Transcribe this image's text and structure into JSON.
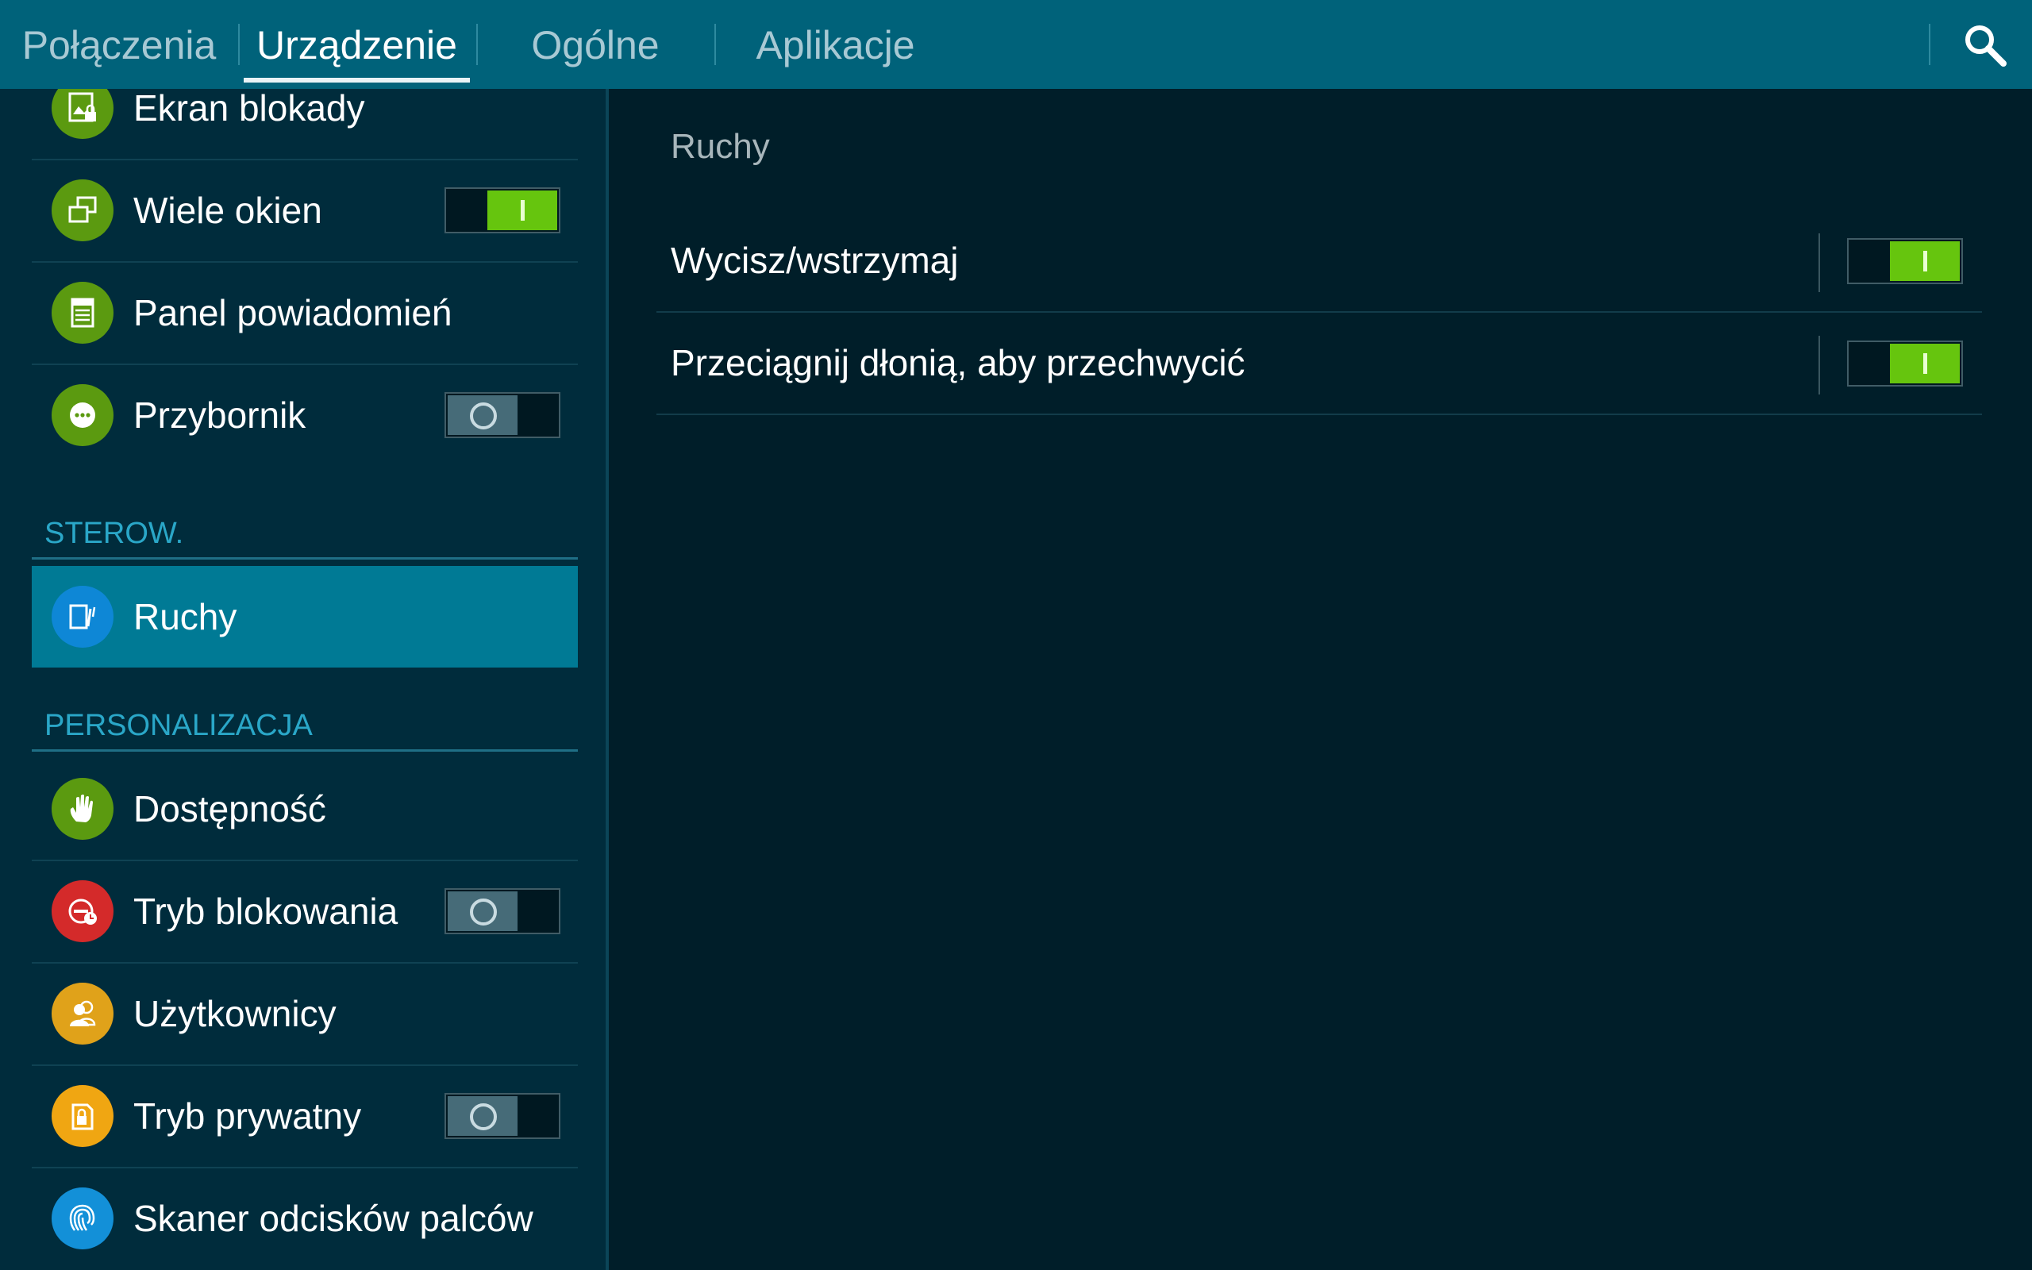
{
  "tabs": [
    {
      "label": "Połączenia",
      "active": false
    },
    {
      "label": "Urządzenie",
      "active": true
    },
    {
      "label": "Ogólne",
      "active": false
    },
    {
      "label": "Aplikacje",
      "active": false
    }
  ],
  "search_icon": "search-icon",
  "left_menu": {
    "items_top": [
      {
        "label": "Ekran blokady",
        "icon": "lock-screen-icon",
        "icon_color": "#5b9a10"
      },
      {
        "label": "Wiele okien",
        "icon": "multi-window-icon",
        "icon_color": "#5b9a10",
        "toggle": "on"
      },
      {
        "label": "Panel powiadomień",
        "icon": "notification-panel-icon",
        "icon_color": "#5b9a10"
      },
      {
        "label": "Przybornik",
        "icon": "toolbox-icon",
        "icon_color": "#5b9a10",
        "toggle": "off"
      }
    ],
    "section_sterow": "STEROW.",
    "ruchy_item": {
      "label": "Ruchy",
      "icon": "motions-icon",
      "icon_color": "#0e87d6",
      "selected": true
    },
    "section_personalizacja": "PERSONALIZACJA",
    "items_bottom": [
      {
        "label": "Dostępność",
        "icon": "accessibility-hand-icon",
        "icon_color": "#5b9a10"
      },
      {
        "label": "Tryb blokowania",
        "icon": "blocking-mode-icon",
        "icon_color": "#d42a2a",
        "toggle": "off"
      },
      {
        "label": "Użytkownicy",
        "icon": "users-icon",
        "icon_color": "#e0a21a"
      },
      {
        "label": "Tryb prywatny",
        "icon": "private-mode-icon",
        "icon_color": "#f0a612",
        "toggle": "off"
      },
      {
        "label": "Skaner odcisków palców",
        "icon": "fingerprint-icon",
        "icon_color": "#1390d8"
      }
    ]
  },
  "detail": {
    "title": "Ruchy",
    "rows": [
      {
        "label": "Wycisz/wstrzymaj",
        "toggle": "on"
      },
      {
        "label": "Przeciągnij dłonią, aby przechwycić",
        "toggle": "on"
      }
    ]
  },
  "colors": {
    "tabbar": "#00627a",
    "left_pane": "#002c3c",
    "right_pane": "#001e29",
    "selected_item": "#007a95",
    "toggle_on": "#66c50e",
    "section_header": "#2aa7c8"
  }
}
